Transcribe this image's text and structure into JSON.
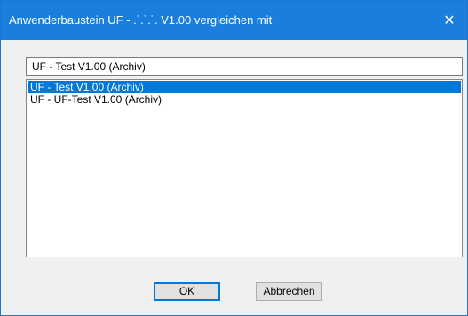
{
  "window": {
    "title": "Anwenderbaustein UF - .˙.˙.˙. V1.00 vergleichen mit",
    "close_glyph": "✕",
    "close_icon": "close-icon"
  },
  "combo": {
    "value": "UF - Test V1.00 (Archiv)"
  },
  "list": {
    "items": [
      {
        "label": "UF - Test V1.00 (Archiv)",
        "selected": true
      },
      {
        "label": "UF - UF-Test V1.00 (Archiv)",
        "selected": false
      }
    ]
  },
  "buttons": {
    "ok_label": "OK",
    "cancel_label": "Abbrechen"
  },
  "colors": {
    "titlebar": "#1a7fdc",
    "selection": "#0078d7",
    "dialog_bg": "#f0f0f0"
  }
}
